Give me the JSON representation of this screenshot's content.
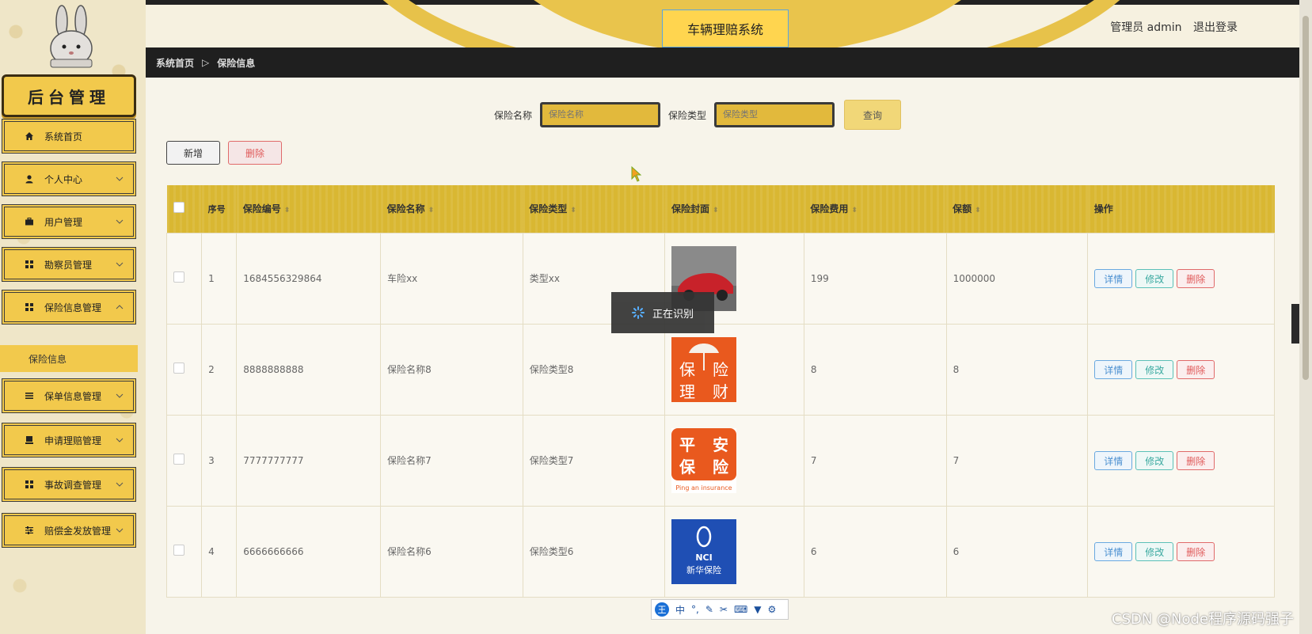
{
  "sidebar": {
    "brand": "后台管理",
    "items": [
      {
        "label": "系统首页",
        "icon": "home-icon"
      },
      {
        "label": "个人中心",
        "icon": "user-icon"
      },
      {
        "label": "用户管理",
        "icon": "briefcase-icon"
      },
      {
        "label": "勘察员管理",
        "icon": "grid-icon"
      },
      {
        "label": "保险信息管理",
        "icon": "grid-icon"
      },
      {
        "label": "保单信息管理",
        "icon": "list-icon"
      },
      {
        "label": "申请理赔管理",
        "icon": "document-icon"
      },
      {
        "label": "事故调查管理",
        "icon": "grid-icon"
      },
      {
        "label": "赔偿金发放管理",
        "icon": "sliders-icon"
      }
    ],
    "submenu": {
      "label": "保险信息"
    }
  },
  "header": {
    "title": "车辆理赔系统",
    "user": "管理员 admin",
    "logout": "退出登录"
  },
  "breadcrumb": {
    "home": "系统首页",
    "sep": "▷",
    "current": "保险信息"
  },
  "search": {
    "name_label": "保险名称",
    "name_placeholder": "保险名称",
    "type_label": "保险类型",
    "type_placeholder": "保险类型",
    "button": "查询"
  },
  "actions": {
    "add": "新增",
    "delete": "删除"
  },
  "table": {
    "headers": {
      "index": "序号",
      "code": "保险编号",
      "name": "保险名称",
      "type": "保险类型",
      "cover": "保险封面",
      "fee": "保险费用",
      "amount": "保额",
      "ops": "操作"
    },
    "sort_glyph": "⬍",
    "ops": {
      "detail": "详情",
      "edit": "修改",
      "delete": "删除"
    },
    "rows": [
      {
        "index": "1",
        "code": "1684556329864",
        "name": "车险xx",
        "type": "类型xx",
        "fee": "199",
        "amount": "1000000",
        "cover": "car"
      },
      {
        "index": "2",
        "code": "8888888888",
        "name": "保险名称8",
        "type": "保险类型8",
        "fee": "8",
        "amount": "8",
        "cover": "umbrella"
      },
      {
        "index": "3",
        "code": "7777777777",
        "name": "保险名称7",
        "type": "保险类型7",
        "fee": "7",
        "amount": "7",
        "cover": "pingan"
      },
      {
        "index": "4",
        "code": "6666666666",
        "name": "保险名称6",
        "type": "保险类型6",
        "fee": "6",
        "amount": "6",
        "cover": "nci"
      }
    ],
    "cover_text": {
      "umbrella": [
        "保",
        "险",
        "理",
        "财"
      ],
      "pingan": [
        "平",
        "安",
        "保",
        "险"
      ],
      "pingan_en": "Ping an insurance",
      "nci_en": "NCI",
      "nci_cn": "新华保险"
    }
  },
  "toast": {
    "text": "正在识别"
  },
  "ime": {
    "badge": "王",
    "mode": "中",
    "punct": "°,"
  },
  "watermark": "CSDN @Node程序源码强子",
  "colors": {
    "accent": "#f2c94c",
    "header_dark": "#1f1f1f",
    "danger": "#e05a5a",
    "info": "#4a8fd0",
    "success": "#3aa9a0"
  }
}
